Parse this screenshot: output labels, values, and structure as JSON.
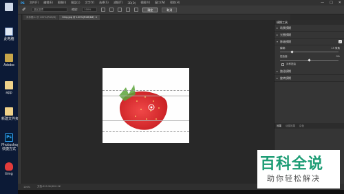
{
  "desktop": {
    "icons": [
      {
        "label": "",
        "icon": "pc-icon",
        "color": "#dfe7f2"
      },
      {
        "label": "此电脑",
        "icon": "pc-icon",
        "color": "#dfe7f2"
      },
      {
        "label": "Adobe",
        "icon": "adobe-folder-icon",
        "color": "#c8a64a"
      },
      {
        "label": "app",
        "icon": "app-folder-icon",
        "color": "#f0d28a"
      },
      {
        "label": "新建文件夹",
        "icon": "new-folder-icon",
        "color": "#f0d28a"
      },
      {
        "label": "Photoshop\n快捷方式",
        "icon": "photoshop-icon",
        "color": "#31a8ff"
      },
      {
        "label": "timg",
        "icon": "image-thumb-icon",
        "color": "#e23b3b"
      }
    ]
  },
  "menubar": {
    "items": [
      "PS",
      "文件(F)",
      "编辑(E)",
      "图像(I)",
      "图层(L)",
      "文字(Y)",
      "选择(S)",
      "滤镜(T)",
      "3D(D)",
      "视图(V)",
      "窗口(W)",
      "帮助(H)"
    ],
    "window_controls": [
      "—",
      "□",
      "✕"
    ]
  },
  "options": {
    "preset": "选区选项",
    "zoom_label": "缩放:",
    "zoom_value": "100%",
    "ok": "确定",
    "cancel": "取消"
  },
  "tabs": [
    {
      "label": "未标题-1 @ 100%(RGB/8)"
    },
    {
      "label": "timg.jpg @ 100%(RGB/8#) ×"
    }
  ],
  "panel": {
    "title": "模糊工具",
    "sections": [
      {
        "label": "场景模糊"
      },
      {
        "label": "光圈模糊"
      },
      {
        "label": "移轴模糊",
        "checked": true
      }
    ],
    "blur_label": "模糊:",
    "blur_value": "15 像素",
    "blur_fraction": 0.2,
    "distortion_label": "扭曲度:",
    "distortion_value": "0%",
    "distortion_fraction": 0.5,
    "symmetric_label": "对称扭曲",
    "more_sections": [
      {
        "label": "路径模糊"
      },
      {
        "label": "旋转模糊"
      }
    ],
    "lower_tabs": [
      "效果",
      "动感效果",
      "杂色"
    ]
  },
  "status": {
    "zoom": "100%",
    "doc": "文档:610.9K/610.9K"
  },
  "watermark": {
    "title": "百科全说",
    "subtitle": "助你轻松解决",
    "color": "#1c9c74"
  }
}
